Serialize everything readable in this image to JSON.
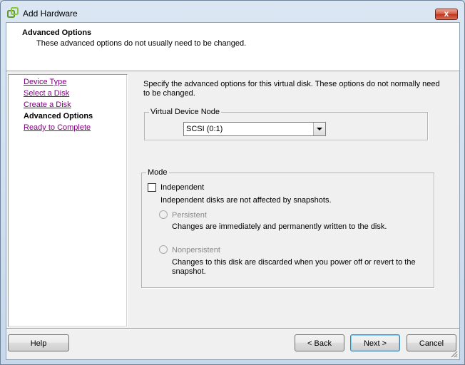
{
  "window": {
    "title": "Add Hardware",
    "close_label": "x"
  },
  "header": {
    "title": "Advanced Options",
    "subtitle": "These advanced options do not usually need to be changed."
  },
  "nav": {
    "items": [
      {
        "label": "Device Type"
      },
      {
        "label": "Select a Disk"
      },
      {
        "label": "Create a Disk"
      },
      {
        "label": "Advanced Options"
      },
      {
        "label": "Ready to Complete"
      }
    ],
    "current_index": 3
  },
  "main": {
    "description": "Specify the advanced options for this virtual disk. These options do not normally need to be changed.",
    "virtual_device_node": {
      "legend": "Virtual Device Node",
      "selected": "SCSI (0:1)"
    },
    "mode": {
      "legend": "Mode",
      "independent_label": "Independent",
      "independent_checked": false,
      "independent_note": "Independent disks are not affected by snapshots.",
      "persistent_label": "Persistent",
      "persistent_note": "Changes are immediately and permanently written to the disk.",
      "nonpersistent_label": "Nonpersistent",
      "nonpersistent_note": "Changes to this disk are discarded when you power off or revert to the snapshot."
    }
  },
  "footer": {
    "help_label": "Help",
    "back_label": "< Back",
    "next_label": "Next >",
    "cancel_label": "Cancel"
  },
  "icons": {
    "app": "vsphere-logo-icon",
    "close": "close-icon",
    "dropdown": "chevron-down-icon",
    "grip": "resize-grip-icon"
  }
}
